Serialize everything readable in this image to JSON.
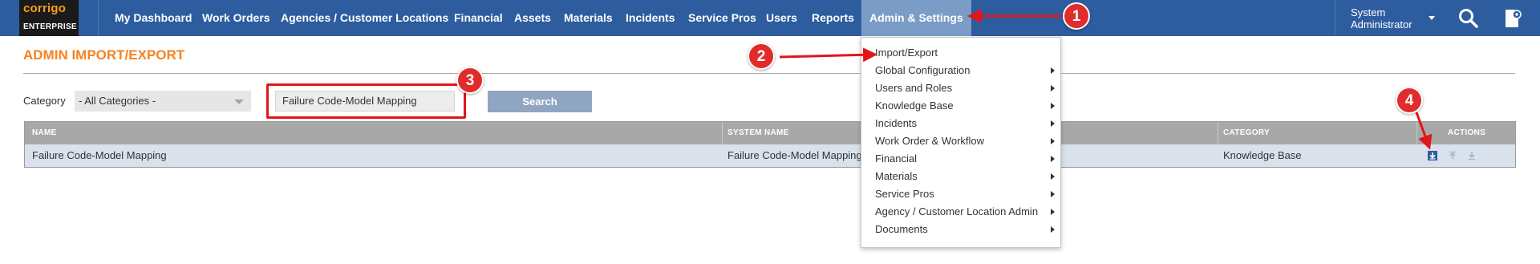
{
  "logo": {
    "line1": "corrigo",
    "line2": "ENTERPRISE"
  },
  "nav": {
    "items": [
      "My Dashboard",
      "Work Orders",
      "Agencies / Customer Locations",
      "Financial",
      "Assets",
      "Materials",
      "Incidents",
      "Service Pros",
      "Users",
      "Reports",
      "Admin & Settings"
    ],
    "active": "Admin & Settings"
  },
  "user": {
    "name": "System Administrator"
  },
  "icons": {
    "search": "search-icon",
    "user_menu": "user-chevron-icon",
    "docs": "document-icon"
  },
  "page": {
    "title": "ADMIN IMPORT/EXPORT"
  },
  "filter": {
    "category_label": "Category",
    "category_value": "- All Categories -",
    "search_value": "Failure Code-Model Mapping",
    "search_button": "Search"
  },
  "table": {
    "headers": [
      "NAME",
      "SYSTEM NAME",
      "CATEGORY",
      "ACTIONS"
    ],
    "rows": [
      {
        "name": "Failure Code-Model Mapping",
        "system_name": "Failure Code-Model Mapping",
        "category": "Knowledge Base"
      }
    ]
  },
  "menu": {
    "items": [
      {
        "label": "Import/Export",
        "has_sub": false
      },
      {
        "label": "Global Configuration",
        "has_sub": true
      },
      {
        "label": "Users and Roles",
        "has_sub": true
      },
      {
        "label": "Knowledge Base",
        "has_sub": true
      },
      {
        "label": "Incidents",
        "has_sub": true
      },
      {
        "label": "Work Order & Workflow",
        "has_sub": true
      },
      {
        "label": "Financial",
        "has_sub": true
      },
      {
        "label": "Materials",
        "has_sub": true
      },
      {
        "label": "Service Pros",
        "has_sub": true
      },
      {
        "label": "Agency / Customer Location Admin",
        "has_sub": true
      },
      {
        "label": "Documents",
        "has_sub": true
      }
    ]
  },
  "annotations": {
    "badges": [
      "1",
      "2",
      "3",
      "4"
    ]
  },
  "colors": {
    "nav_bg": "#2d5d9f",
    "accent": "#f58220",
    "annotation": "#e02c2c"
  }
}
